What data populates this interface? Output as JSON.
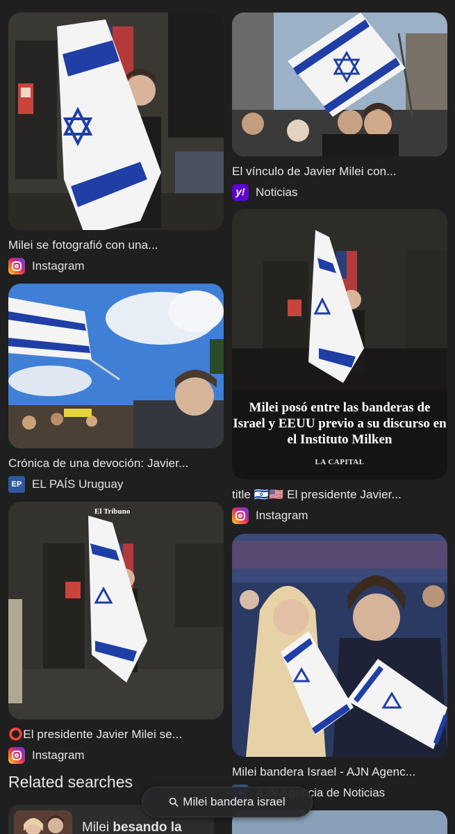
{
  "results": {
    "left": [
      {
        "caption": "Milei se fotografió con una...",
        "source": "Instagram",
        "source_icon": "instagram-icon"
      },
      {
        "caption": "Crónica de una devoción: Javier...",
        "source": "EL PAÍS Uruguay",
        "source_icon": "el-pais-icon",
        "source_icon_text": "EP"
      },
      {
        "caption": "⭕El presidente Javier Milei se...",
        "source": "Instagram",
        "source_icon": "instagram-icon",
        "watermark": "El Tribuno"
      }
    ],
    "right": [
      {
        "caption": "El vínculo de Javier Milei con...",
        "source": "Noticias",
        "source_icon": "yahoo-icon",
        "source_icon_text": "y!"
      },
      {
        "caption": "title 🇮🇱🇺🇸 El presidente Javier...",
        "source": "Instagram",
        "source_icon": "instagram-icon",
        "overlay_text": "Milei posó entre las banderas de Israel y EEUU previo a su discurso en el Instituto Milken",
        "overlay_brand": "LA CAPITAL"
      },
      {
        "caption": "Milei bandera Israel - AJN Agenc...",
        "source": "AJN Agencia de Noticias",
        "source_icon": "ajn-icon"
      }
    ]
  },
  "related": {
    "title": "Related searches",
    "items": [
      {
        "label_prefix": "Milei ",
        "label_bold": "besando la"
      }
    ]
  },
  "search_pill": {
    "query": "Milei bandera israel",
    "icon": "search-icon"
  },
  "colors": {
    "background": "#1f1f1f",
    "flag_blue": "#1f3fa6",
    "flag_white": "#f4f4f4"
  }
}
